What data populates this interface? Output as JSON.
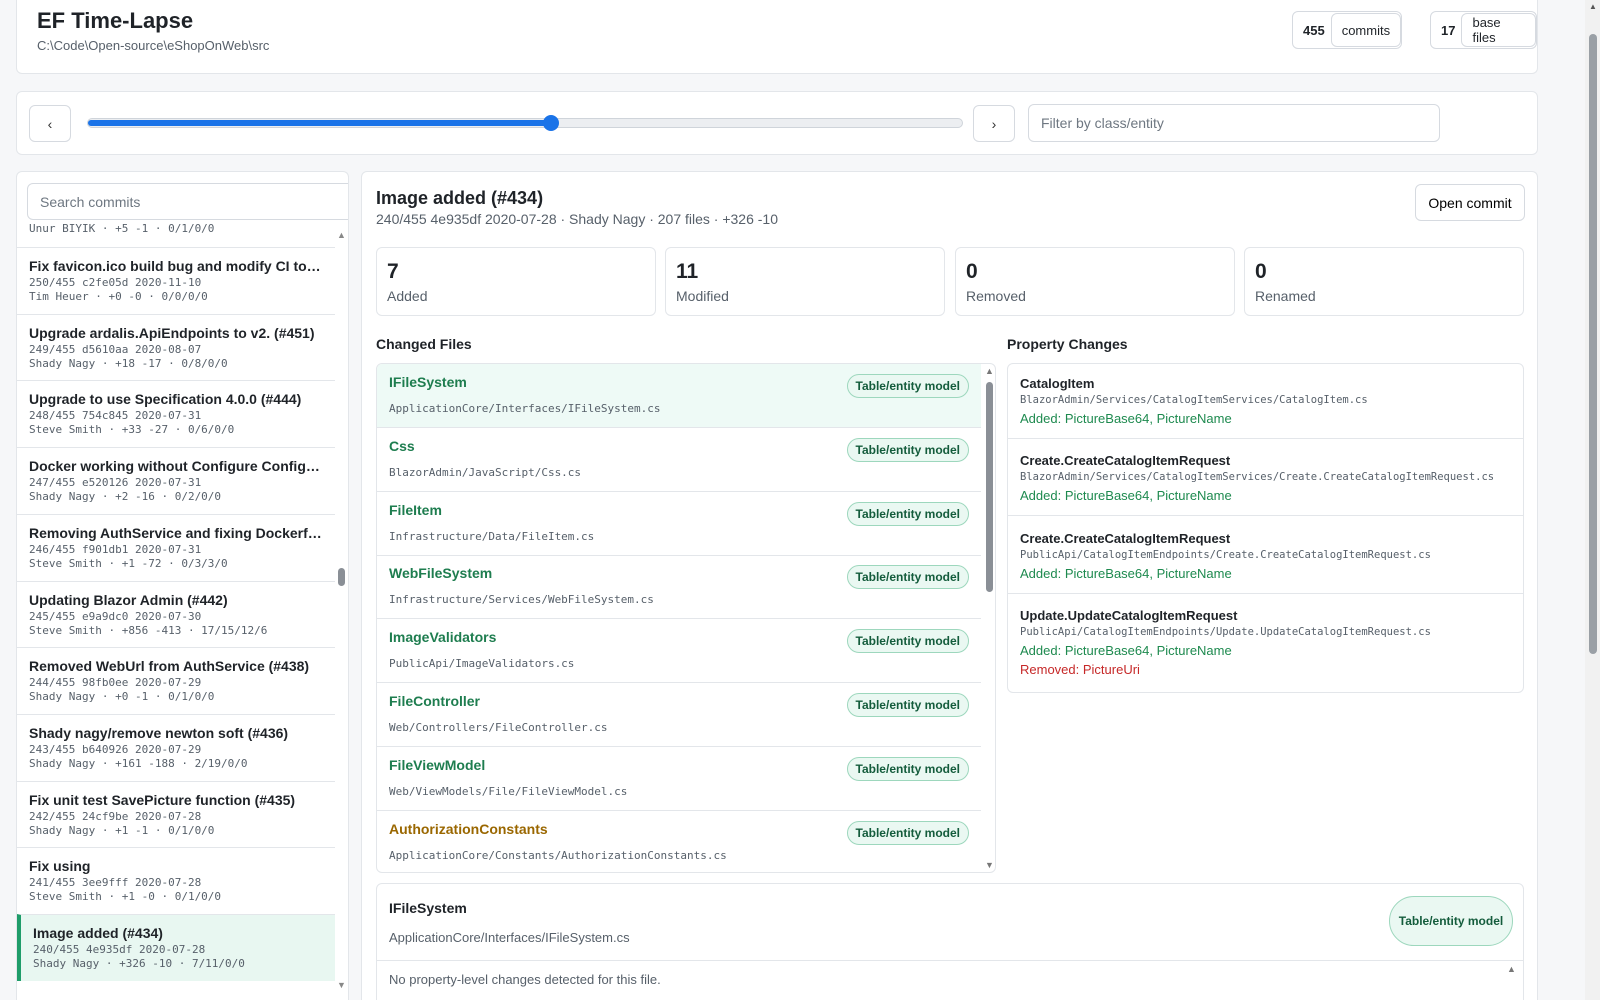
{
  "header": {
    "title": "EF Time-Lapse",
    "path": "C:\\Code\\Open-source\\eShopOnWeb\\src",
    "commits_count": "455",
    "commits_label": "commits",
    "base_files_count": "17",
    "base_files_label": "base files"
  },
  "slider": {
    "prev_label": "‹",
    "next_label": "›",
    "position": 0.53,
    "filter_placeholder": "Filter by class/entity"
  },
  "commit_list": {
    "search_placeholder": "Search commits",
    "partial_top": "Unur BIYIK · +5 -1 · 0/1/0/0",
    "items": [
      {
        "title": "Fix favicon.ico build bug and modify CI to ru...",
        "meta": "250/455 c2fe05d 2020-11-10",
        "stats": "Tim Heuer · +0 -0 · 0/0/0/0"
      },
      {
        "title": "Upgrade ardalis.ApiEndpoints to v2. (#451)",
        "meta": "249/455 d5610aa 2020-08-07",
        "stats": "Shady Nagy · +18 -17 · 0/8/0/0"
      },
      {
        "title": "Upgrade to use Specification 4.0.0 (#444)",
        "meta": "248/455 754c845 2020-07-31",
        "stats": "Steve Smith · +33 -27 · 0/6/0/0"
      },
      {
        "title": "Docker working without Configure Configure...",
        "meta": "247/455 e520126 2020-07-31",
        "stats": "Shady Nagy · +2 -16 · 0/2/0/0"
      },
      {
        "title": "Removing AuthService and fixing Dockerfile ...",
        "meta": "246/455 f901db1 2020-07-31",
        "stats": "Steve Smith · +1 -72 · 0/3/3/0"
      },
      {
        "title": "Updating Blazor Admin (#442)",
        "meta": "245/455 e9a9dc0 2020-07-30",
        "stats": "Steve Smith · +856 -413 · 17/15/12/6"
      },
      {
        "title": "Removed WebUrl from AuthService (#438)",
        "meta": "244/455 98fb0ee 2020-07-29",
        "stats": "Shady Nagy · +0 -1 · 0/1/0/0"
      },
      {
        "title": "Shady nagy/remove newton soft (#436)",
        "meta": "243/455 b640926 2020-07-29",
        "stats": "Shady Nagy · +161 -188 · 2/19/0/0"
      },
      {
        "title": "Fix unit test SavePicture function (#435)",
        "meta": "242/455 24cf9be 2020-07-28",
        "stats": "Shady Nagy · +1 -1 · 0/1/0/0"
      },
      {
        "title": "Fix using",
        "meta": "241/455 3ee9fff 2020-07-28",
        "stats": "Steve Smith · +1 -0 · 0/1/0/0"
      },
      {
        "title": "Image added (#434)",
        "meta": "240/455 4e935df 2020-07-28",
        "stats": "Shady Nagy · +326 -10 · 7/11/0/0"
      }
    ]
  },
  "commit": {
    "title": "Image added (#434)",
    "meta": "240/455 4e935df 2020-07-28 · Shady Nagy · 207 files · +326 -10",
    "open_label": "Open commit",
    "counts": [
      {
        "value": "7",
        "label": "Added"
      },
      {
        "value": "11",
        "label": "Modified"
      },
      {
        "value": "0",
        "label": "Removed"
      },
      {
        "value": "0",
        "label": "Renamed"
      }
    ]
  },
  "changed_files": {
    "title": "Changed Files",
    "badge_label": "Table/entity model",
    "files": [
      {
        "name": "IFileSystem",
        "path": "ApplicationCore/Interfaces/IFileSystem.cs"
      },
      {
        "name": "Css",
        "path": "BlazorAdmin/JavaScript/Css.cs"
      },
      {
        "name": "FileItem",
        "path": "Infrastructure/Data/FileItem.cs"
      },
      {
        "name": "WebFileSystem",
        "path": "Infrastructure/Services/WebFileSystem.cs"
      },
      {
        "name": "ImageValidators",
        "path": "PublicApi/ImageValidators.cs"
      },
      {
        "name": "FileController",
        "path": "Web/Controllers/FileController.cs"
      },
      {
        "name": "FileViewModel",
        "path": "Web/ViewModels/File/FileViewModel.cs"
      },
      {
        "name": "AuthorizationConstants",
        "path": "ApplicationCore/Constants/AuthorizationConstants.cs"
      }
    ]
  },
  "property_changes": {
    "title": "Property Changes",
    "items": [
      {
        "cls": "CatalogItem",
        "path": "BlazorAdmin/Services/CatalogItemServices/CatalogItem.cs",
        "added": "Added: PictureBase64, PictureName",
        "removed": ""
      },
      {
        "cls": "Create.CreateCatalogItemRequest",
        "path": "BlazorAdmin/Services/CatalogItemServices/Create.CreateCatalogItemRequest.cs",
        "added": "Added: PictureBase64, PictureName",
        "removed": ""
      },
      {
        "cls": "Create.CreateCatalogItemRequest",
        "path": "PublicApi/CatalogItemEndpoints/Create.CreateCatalogItemRequest.cs",
        "added": "Added: PictureBase64, PictureName",
        "removed": ""
      },
      {
        "cls": "Update.UpdateCatalogItemRequest",
        "path": "PublicApi/CatalogItemEndpoints/Update.UpdateCatalogItemRequest.cs",
        "added": "Added: PictureBase64, PictureName",
        "removed": "Removed: PictureUri"
      }
    ]
  },
  "detail": {
    "name": "IFileSystem",
    "path": "ApplicationCore/Interfaces/IFileSystem.cs",
    "badge": "Table/entity model",
    "note": "No property-level changes detected for this file."
  },
  "colors": {
    "accent": "#1a73e8",
    "added": "#1e8a4f",
    "removed": "#c62828",
    "selected_bg": "#e8f7f1"
  }
}
